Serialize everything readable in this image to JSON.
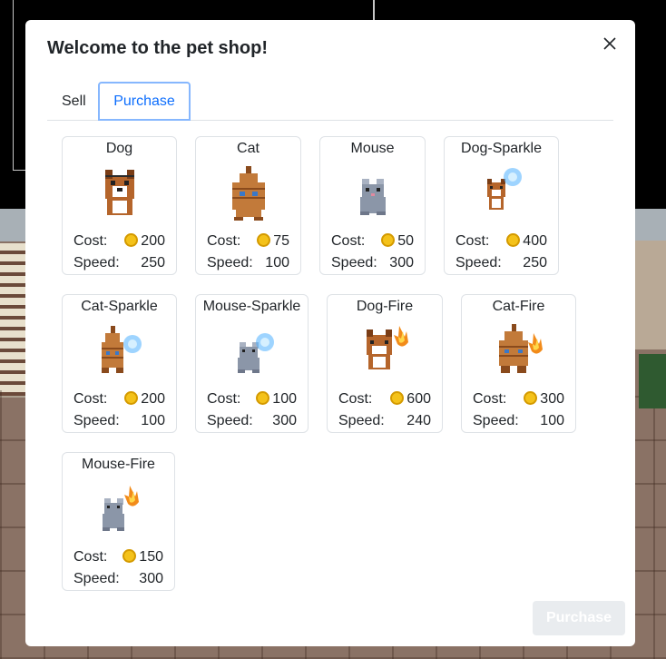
{
  "modal": {
    "title": "Welcome to the pet shop!",
    "close_label": "×"
  },
  "tabs": [
    {
      "label": "Sell",
      "active": false
    },
    {
      "label": "Purchase",
      "active": true
    }
  ],
  "labels": {
    "cost": "Cost:",
    "speed": "Speed:"
  },
  "pets": [
    {
      "name": "Dog",
      "cost": "200",
      "speed": "250",
      "icon": "dog-sprite"
    },
    {
      "name": "Cat",
      "cost": "75",
      "speed": "100",
      "icon": "cat-sprite"
    },
    {
      "name": "Mouse",
      "cost": "50",
      "speed": "300",
      "icon": "mouse-sprite"
    },
    {
      "name": "Dog-Sparkle",
      "cost": "400",
      "speed": "250",
      "icon": "dog-sparkle-sprite"
    },
    {
      "name": "Cat-Sparkle",
      "cost": "200",
      "speed": "100",
      "icon": "cat-sparkle-sprite"
    },
    {
      "name": "Mouse-Sparkle",
      "cost": "100",
      "speed": "300",
      "icon": "mouse-sparkle-sprite"
    },
    {
      "name": "Dog-Fire",
      "cost": "600",
      "speed": "240",
      "icon": "dog-fire-sprite"
    },
    {
      "name": "Cat-Fire",
      "cost": "300",
      "speed": "100",
      "icon": "cat-fire-sprite"
    },
    {
      "name": "Mouse-Fire",
      "cost": "150",
      "speed": "300",
      "icon": "mouse-fire-sprite"
    }
  ],
  "footer": {
    "purchase_label": "Purchase"
  },
  "colors": {
    "accent": "#0d6efd",
    "coin": "#f4c21a",
    "dog": "#b5652b",
    "cat": "#c27a3a",
    "mouse": "#8b96a8",
    "sparkle": "#4fb0ff",
    "fire": "#f28b1a"
  }
}
